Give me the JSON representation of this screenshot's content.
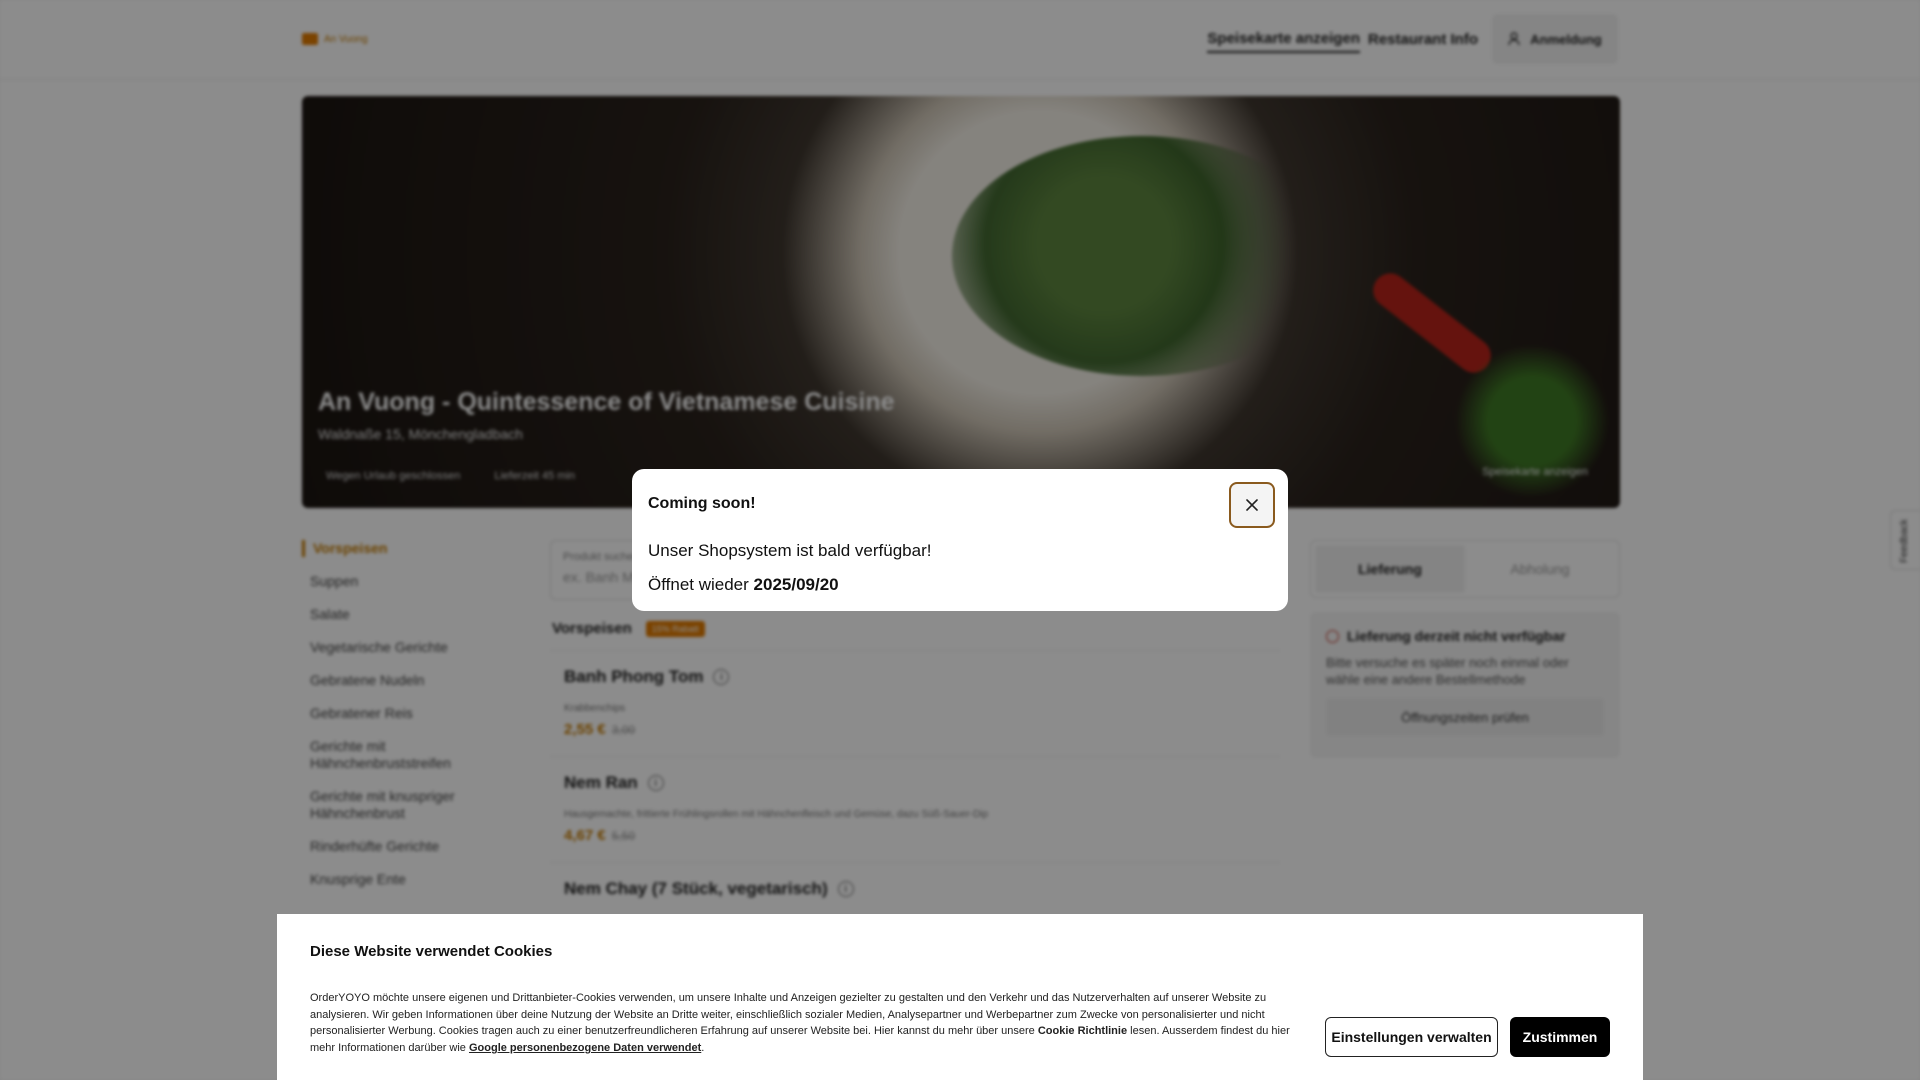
{
  "header": {
    "logo_text": "An Vuong",
    "nav": {
      "menu_label": "Speisekarte anzeigen",
      "info_label": "Restaurant Info",
      "login_label": "Anmeldung"
    }
  },
  "hero": {
    "title": "An Vuong - Quintessence of Vietnamese Cuisine",
    "address": "Waldnaße 15, Mönchengladbach",
    "status": "Wegen Urlaub geschlossen",
    "delivery_time": "Lieferzeit 45 min",
    "menu_button": "Speisekarte anzeigen"
  },
  "sidebar": {
    "categories": [
      "Vorspeisen",
      "Suppen",
      "Salate",
      "Vegetarische Gerichte",
      "Gebratene Nudeln",
      "Gebratener Reis",
      "Gerichte mit Hähnchenbruststreifen",
      "Gerichte mit knuspriger Hähnchenbrust",
      "Rinderhüfte Gerichte",
      "Knusprige Ente"
    ]
  },
  "content": {
    "search_label": "Produkt suchen",
    "search_placeholder": "ex. Banh Mi",
    "section_title": "Vorspeisen",
    "section_badge": "15% Rabatt",
    "products": [
      {
        "name": "Banh Phong Tom",
        "desc": "Krabbenchips",
        "price": "2,55 €",
        "old_price": "3,00"
      },
      {
        "name": "Nem Ran",
        "desc": "Hausgemachte, frittierte Frühlingsrollen mit Hähnchenfleisch und Gemüse, dazu Süß-Sauer-Dip",
        "price": "4,67 €",
        "old_price": "5,50"
      },
      {
        "name": "Nem Chay (7 Stück, vegetarisch)",
        "desc": "",
        "price": "",
        "old_price": ""
      }
    ]
  },
  "order_panel": {
    "tab_delivery": "Lieferung",
    "tab_pickup": "Abholung",
    "notice_title": "Lieferung derzeit nicht verfügbar",
    "notice_text": "Bitte versuche es später noch einmal oder wähle eine andere Bestellmethode",
    "notice_button": "Öffnungszeiten prüfen"
  },
  "feedback_label": "Feedback",
  "modal": {
    "title": "Coming soon!",
    "line1": "Unser Shopsystem ist bald verfügbar!",
    "line2_prefix": "Öffnet wieder",
    "line2_date": "2025/09/20"
  },
  "cookie": {
    "title": "Diese Website verwendet Cookies",
    "text_part1": "OrderYOYO möchte unsere eigenen und Drittanbieter-Cookies verwenden, um unsere Inhalte und Anzeigen gezielter zu gestalten und den Verkehr und das Nutzerverhalten auf unserer Website zu analysieren. Wir geben Informationen über deine Nutzung der Website an Dritte weiter, einschließlich sozialer Medien, Analysepartner und Werbepartner zum Zwecke von personalisierter und nicht personalisierter Werbung. Cookies tragen auch zu einer benutzerfreundlicheren Erfahrung auf unserer Website bei. Hier kannst du mehr über unsere",
    "policy_link": "Cookie Richtlinie",
    "text_part2": "lesen. Ausserdem findest du hier mehr Informationen darüber wie",
    "google_link": "Google personenbezogene Daten verwendet",
    "text_end": ".",
    "settings_button": "Einstellungen verwalten",
    "accept_button": "Zustimmen"
  },
  "colors": {
    "accent": "#c47a00",
    "modal_close_border": "#8a5a1e",
    "accept_bg": "#000000"
  }
}
